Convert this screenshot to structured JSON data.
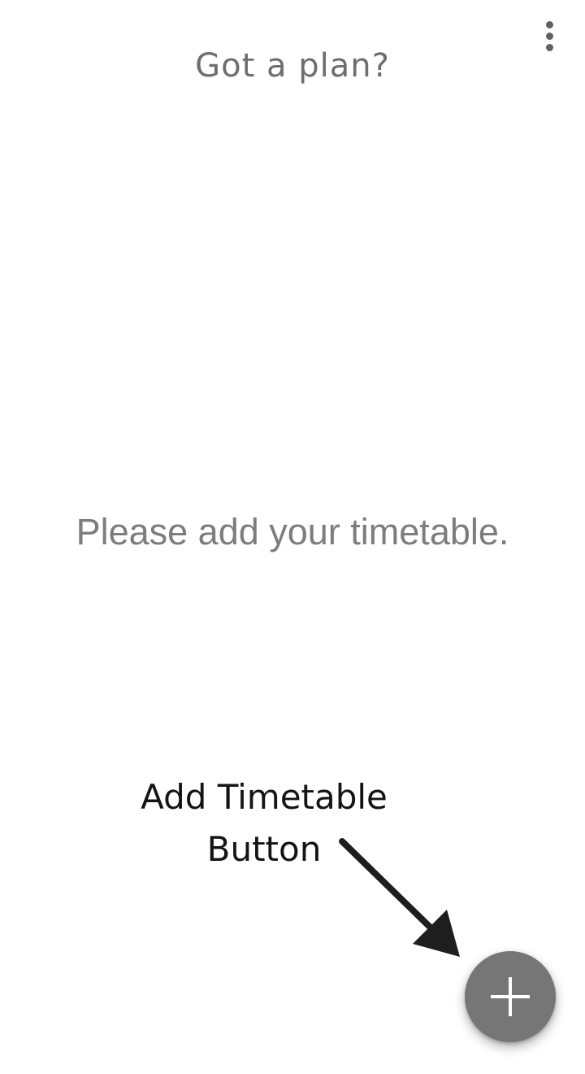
{
  "header": {
    "title": "Got a plan?",
    "menu_icon": "more-vert-icon"
  },
  "main": {
    "empty_message": "Please add your timetable."
  },
  "annotation": {
    "line1": "Add Timetable",
    "line2": "Button",
    "arrow_icon": "arrow-icon"
  },
  "fab": {
    "icon": "plus-icon",
    "color": "#767676"
  },
  "colors": {
    "background": "#ffffff",
    "title_text": "#6e6e6e",
    "message_text": "#7d7d7d",
    "annotation_text": "#141414"
  }
}
